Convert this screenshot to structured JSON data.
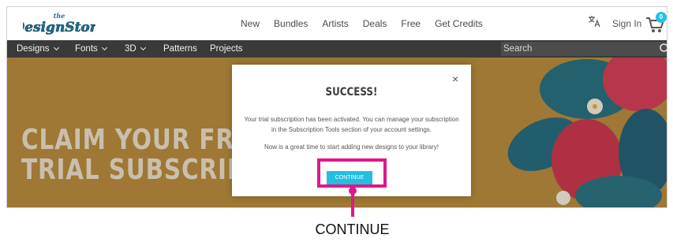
{
  "header": {
    "logo_alt": "the Design Store",
    "nav": [
      "New",
      "Bundles",
      "Artists",
      "Deals",
      "Free",
      "Get Credits"
    ],
    "sign_in": "Sign In",
    "cart_count": "0"
  },
  "navbar": {
    "items": [
      "Designs",
      "Fonts",
      "3D",
      "Patterns",
      "Projects"
    ],
    "search_placeholder": "Search"
  },
  "hero": {
    "headline_line1": "CLAIM YOUR FREE",
    "headline_line2": "TRIAL SUBSCRIPT"
  },
  "modal": {
    "close": "×",
    "title": "SUCCESS!",
    "message1": "Your trial subscription has been activated. You can manage your subscription in the Subscription Tools section of your account settings.",
    "message2": "Now is a great time to start adding new designs to your library!",
    "continue_label": "CONTINUE"
  },
  "annotation": {
    "callout": "CONTINUE",
    "color": "#e2168a"
  },
  "colors": {
    "accent": "#22bfe0",
    "navbar": "#3a3a3a",
    "hero_bg": "#b48a3e"
  }
}
